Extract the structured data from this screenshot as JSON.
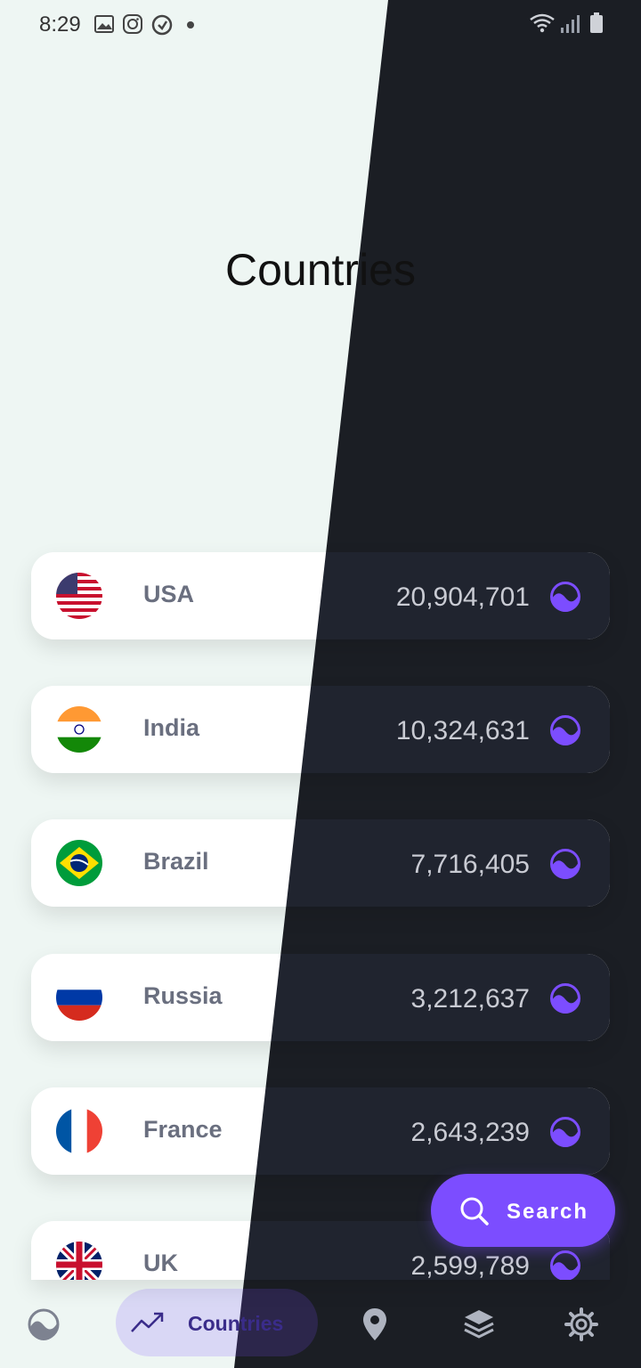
{
  "status_bar": {
    "time": "8:29"
  },
  "page": {
    "title": "Countries"
  },
  "countries": [
    {
      "name": "USA",
      "count": "20,904,701",
      "flag": "usa-flag-icon"
    },
    {
      "name": "India",
      "count": "10,324,631",
      "flag": "india-flag-icon"
    },
    {
      "name": "Brazil",
      "count": "7,716,405",
      "flag": "brazil-flag-icon"
    },
    {
      "name": "Russia",
      "count": "3,212,637",
      "flag": "russia-flag-icon"
    },
    {
      "name": "France",
      "count": "2,643,239",
      "flag": "france-flag-icon"
    },
    {
      "name": "UK",
      "count": "2,599,789",
      "flag": "uk-flag-icon"
    }
  ],
  "fab": {
    "label": "Search"
  },
  "bottom_nav": {
    "items": [
      {
        "name": "home-wave-icon"
      },
      {
        "name": "countries-trend-icon",
        "label": "Countries",
        "active": true
      },
      {
        "name": "location-pin-icon"
      },
      {
        "name": "layers-icon"
      },
      {
        "name": "settings-gear-icon"
      }
    ]
  },
  "colors": {
    "accent": "#7c4dff",
    "light_bg": "#eef6f3",
    "dark_bg": "#1b1e24",
    "card_dark": "#20242f"
  }
}
